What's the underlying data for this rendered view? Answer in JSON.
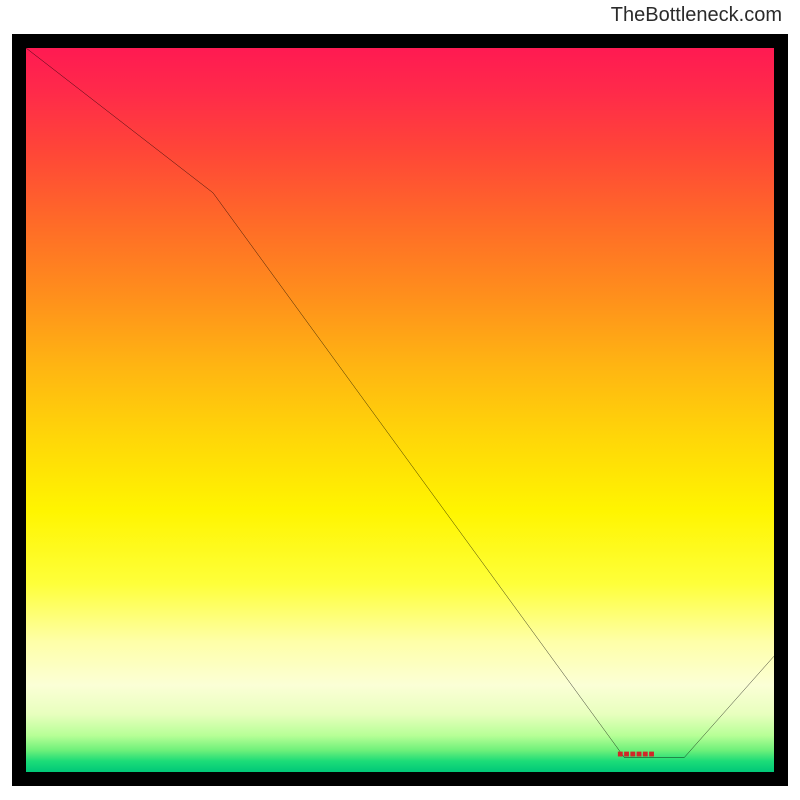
{
  "attribution": "TheBottleneck.com",
  "chart_data": {
    "type": "line",
    "title": "",
    "xlabel": "",
    "ylabel": "",
    "xlim": [
      0,
      100
    ],
    "ylim": [
      0,
      100
    ],
    "x": [
      0,
      25,
      80,
      88,
      100
    ],
    "values": [
      100,
      80,
      2,
      2,
      16
    ],
    "series_color": "#000000",
    "gradient_stops": [
      {
        "pos": 0.0,
        "color": "#ff1a52"
      },
      {
        "pos": 0.24,
        "color": "#ff6a28"
      },
      {
        "pos": 0.54,
        "color": "#ffd708"
      },
      {
        "pos": 0.82,
        "color": "#feffa8"
      },
      {
        "pos": 1.0,
        "color": "#00c878"
      }
    ],
    "annotations": [
      {
        "text": "■■■■■■",
        "x": 84,
        "y": 3
      }
    ]
  }
}
